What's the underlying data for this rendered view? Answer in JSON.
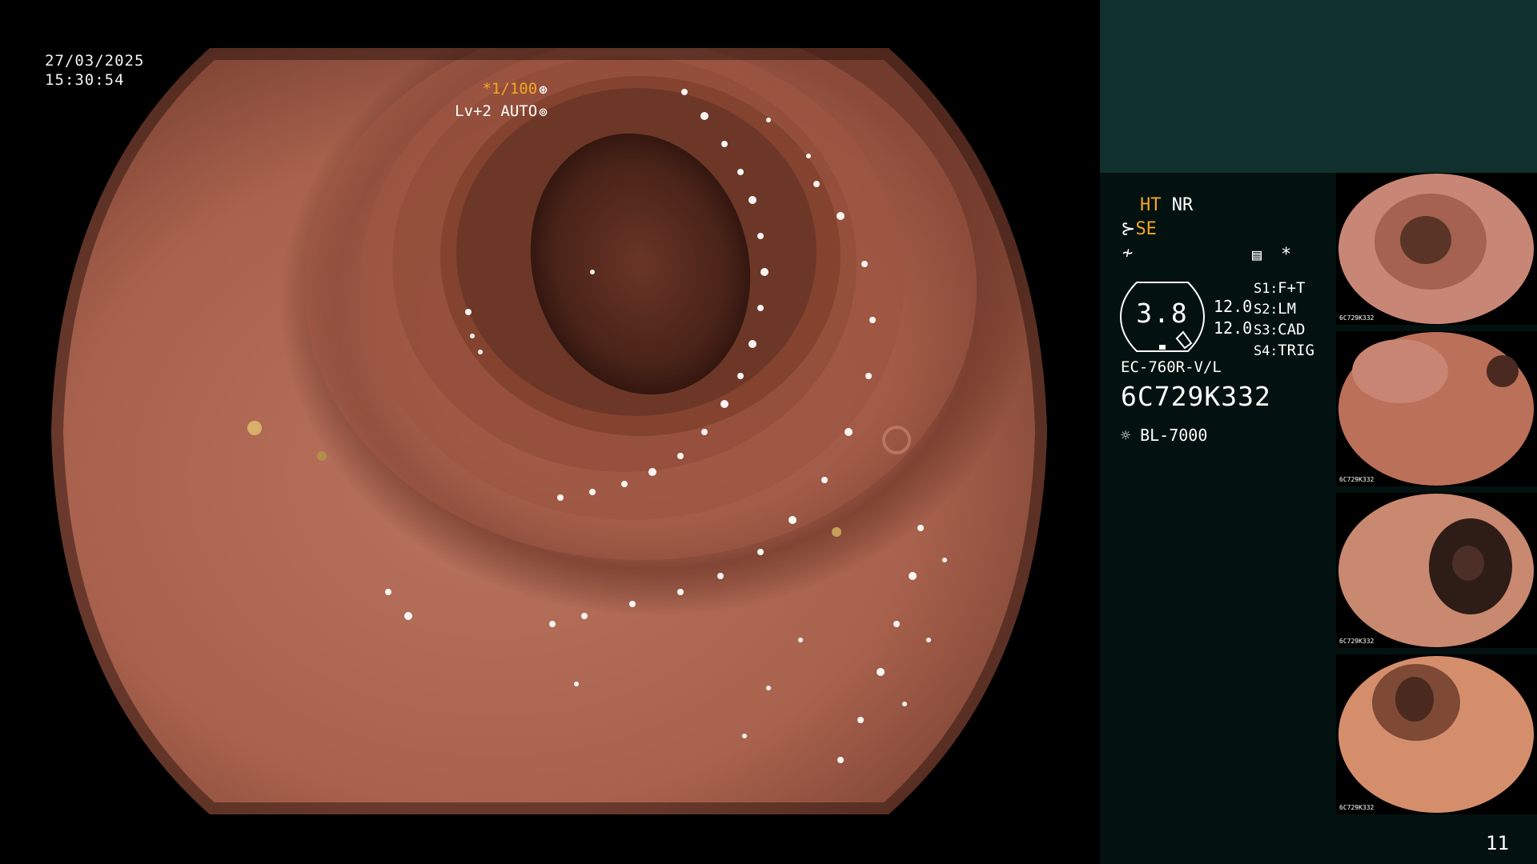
{
  "endoscope_view": {
    "date": "27/03/2025",
    "time": "15:30:54",
    "shutter": "*1/100",
    "shutter_icon": "aperture-icon",
    "level": "Lv+2",
    "exposure_mode": "AUTO",
    "exposure_icon": "iris-icon"
  },
  "info_panel": {
    "ht": "HT",
    "nr": "NR",
    "se": "SE",
    "gauge_value": "3.8",
    "values": [
      "12.0",
      "12.0"
    ],
    "switches": [
      {
        "key": "S1",
        "value": "F+T"
      },
      {
        "key": "S2",
        "value": "LM"
      },
      {
        "key": "S3",
        "value": "CAD"
      },
      {
        "key": "S4",
        "value": "TRIG"
      }
    ],
    "asterisk": "*",
    "scope_model": "EC-760R-V/L",
    "scope_serial": "6C729K332",
    "light_source": "BL-7000",
    "page_number": "11"
  },
  "thumbnails": {
    "count": 4,
    "caption": "6C729K332",
    "footer": "BL-7000"
  },
  "colors": {
    "panel_bg": "#031210",
    "panel_header_bg": "#0f302c",
    "accent_orange": "#f5a623",
    "mucosa": "#b5705c"
  }
}
